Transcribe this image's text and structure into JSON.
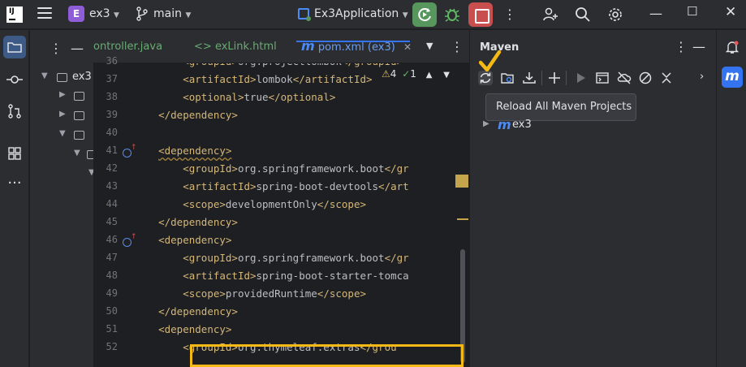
{
  "titlebar": {
    "project_initial": "E",
    "project_name": "ex3",
    "branch": "main",
    "run_config": "Ex3Application"
  },
  "editor": {
    "tabs": [
      {
        "label": "ontroller.java"
      },
      {
        "label": "exLink.html"
      },
      {
        "label": "pom.xml (ex3)"
      }
    ],
    "inspections": {
      "warnings": "4",
      "ok": "1"
    },
    "lines": [
      {
        "n": "36",
        "indent": "        ",
        "tag": "<groupId>",
        "text": "org.projectlombok</groupId>"
      },
      {
        "n": "37",
        "indent": "        ",
        "tag": "<artifactId>",
        "text": "lombok</artifactId>"
      },
      {
        "n": "38",
        "indent": "        ",
        "tag": "<optional>",
        "text": "true</optional>"
      },
      {
        "n": "39",
        "indent": "    ",
        "tag": "</dependency>",
        "text": ""
      },
      {
        "n": "40",
        "indent": "",
        "tag": "",
        "text": ""
      },
      {
        "n": "41",
        "indent": "    ",
        "tag": "<dependency>",
        "text": ""
      },
      {
        "n": "42",
        "indent": "        ",
        "tag": "<groupId>",
        "text": "org.springframework.boot</gr"
      },
      {
        "n": "43",
        "indent": "        ",
        "tag": "<artifactId>",
        "text": "spring-boot-devtools</art"
      },
      {
        "n": "44",
        "indent": "        ",
        "tag": "<scope>",
        "text": "developmentOnly</scope>"
      },
      {
        "n": "45",
        "indent": "    ",
        "tag": "</dependency>",
        "text": ""
      },
      {
        "n": "46",
        "indent": "    ",
        "tag": "<dependency>",
        "text": ""
      },
      {
        "n": "47",
        "indent": "        ",
        "tag": "<groupId>",
        "text": "org.springframework.boot</gr"
      },
      {
        "n": "48",
        "indent": "        ",
        "tag": "<artifactId>",
        "text": "spring-boot-starter-tomca"
      },
      {
        "n": "49",
        "indent": "        ",
        "tag": "<scope>",
        "text": "providedRuntime</scope>"
      },
      {
        "n": "50",
        "indent": "    ",
        "tag": "</dependency>",
        "text": ""
      },
      {
        "n": "51",
        "indent": "    ",
        "tag": "<dependency>",
        "text": ""
      },
      {
        "n": "52",
        "indent": "        ",
        "tag": "<groupId>",
        "text": "org.thymeleaf.extras</grou"
      }
    ]
  },
  "project_tree": {
    "root": "ex3"
  },
  "maven": {
    "title": "Maven",
    "tooltip": "Reload All Maven Projects",
    "tree_root": "ex3"
  },
  "colors": {
    "accent": "#3574f0",
    "highlight": "#f5b915",
    "tag": "#d5b778"
  }
}
